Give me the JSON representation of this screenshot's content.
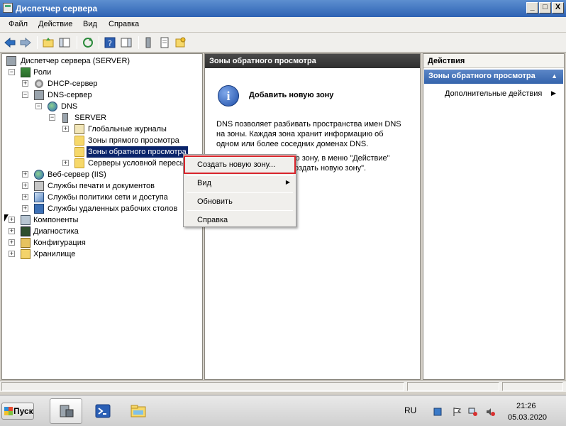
{
  "window": {
    "title": "Диспетчер сервера",
    "minimize": "_",
    "maximize": "□",
    "close": "X"
  },
  "menu": [
    "Файл",
    "Действие",
    "Вид",
    "Справка"
  ],
  "tree": {
    "root": "Диспетчер сервера (SERVER)",
    "roles": "Роли",
    "dhcp": "DHCP-сервер",
    "dns_server": "DNS-сервер",
    "dns": "DNS",
    "server": "SERVER",
    "global_logs": "Глобальные журналы",
    "forward_zones": "Зоны прямого просмотра",
    "reverse_zones": "Зоны обратного просмотра",
    "conditional": "Серверы условной пересы",
    "iis": "Веб-сервер (IIS)",
    "print": "Службы печати и документов",
    "nps": "Службы политики сети и доступа",
    "rds": "Службы удаленных рабочих столов",
    "components": "Компоненты",
    "diagnostics": "Диагностика",
    "configuration": "Конфигурация",
    "storage": "Хранилище",
    "expand_plus": "+",
    "expand_minus": "−"
  },
  "center": {
    "header": "Зоны обратного просмотра",
    "info_glyph": "i",
    "title": "Добавить новую зону",
    "description": "DNS позволяет разбивать пространства имен DNS на зоны. Каждая зона хранит информацию об одном или более соседних доменах DNS.",
    "hint_line1": "Чтобы добавить новую зону, в меню \"Действие\"",
    "hint_line2": "выберите команду \"Создать новую зону\"."
  },
  "actions": {
    "header": "Действия",
    "section": "Зоны обратного просмотра",
    "section_arrow": "▲",
    "more": "Дополнительные действия",
    "more_arrow": "▶"
  },
  "context_menu": {
    "create_zone": "Создать новую зону...",
    "view": "Вид",
    "view_arrow": "▶",
    "refresh": "Обновить",
    "help": "Справка"
  },
  "taskbar": {
    "start": "Пуск",
    "language": "RU",
    "time": "21:26",
    "date": "05.03.2020"
  },
  "colors": {
    "title_bar": "#2e62b3",
    "pane_header": "#2f2f2f",
    "action_section": "#3463ac",
    "selection": "#0a246a",
    "highlight_outline": "#d8242b"
  }
}
